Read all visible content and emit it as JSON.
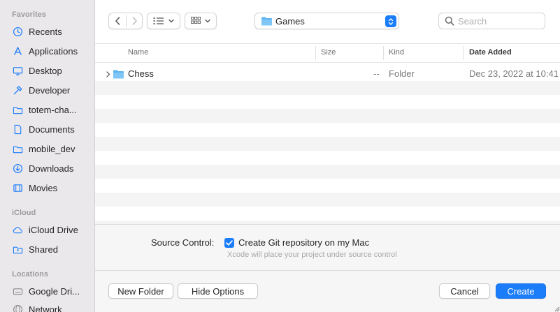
{
  "sidebar": {
    "sections": [
      {
        "title": "Favorites",
        "items": [
          {
            "label": "Recents",
            "icon": "clock-icon"
          },
          {
            "label": "Applications",
            "icon": "applications-icon"
          },
          {
            "label": "Desktop",
            "icon": "desktop-icon"
          },
          {
            "label": "Developer",
            "icon": "hammer-icon"
          },
          {
            "label": "totem-cha...",
            "icon": "folder-icon"
          },
          {
            "label": "Documents",
            "icon": "document-icon"
          },
          {
            "label": "mobile_dev",
            "icon": "folder-icon"
          },
          {
            "label": "Downloads",
            "icon": "download-icon"
          },
          {
            "label": "Movies",
            "icon": "film-icon"
          }
        ]
      },
      {
        "title": "iCloud",
        "items": [
          {
            "label": "iCloud Drive",
            "icon": "cloud-icon"
          },
          {
            "label": "Shared",
            "icon": "shared-folder-icon"
          }
        ]
      },
      {
        "title": "Locations",
        "items": [
          {
            "label": "Google Dri...",
            "icon": "drive-icon"
          },
          {
            "label": "Network",
            "icon": "globe-icon"
          }
        ]
      }
    ]
  },
  "toolbar": {
    "back_icon": "chevron-left-icon",
    "forward_icon": "chevron-right-icon",
    "list_view_icon": "list-icon",
    "grid_view_icon": "grid-icon",
    "path": "Games",
    "search_placeholder": "Search"
  },
  "columns": {
    "name": "Name",
    "size": "Size",
    "kind": "Kind",
    "date_added": "Date Added"
  },
  "files": [
    {
      "name": "Chess",
      "size": "--",
      "kind": "Folder",
      "date_added": "Dec 23, 2022 at 10:41"
    }
  ],
  "options": {
    "source_control_label": "Source Control:",
    "git_checkbox_label": "Create Git repository on my Mac",
    "git_checked": true,
    "note": "Xcode will place your project under source control"
  },
  "footer": {
    "new_folder": "New Folder",
    "hide_options": "Hide Options",
    "cancel": "Cancel",
    "create": "Create"
  },
  "colors": {
    "accent": "#1b7dfa",
    "sidebar_bg": "#ebe8eb",
    "row_alt": "#f4f4f4"
  }
}
